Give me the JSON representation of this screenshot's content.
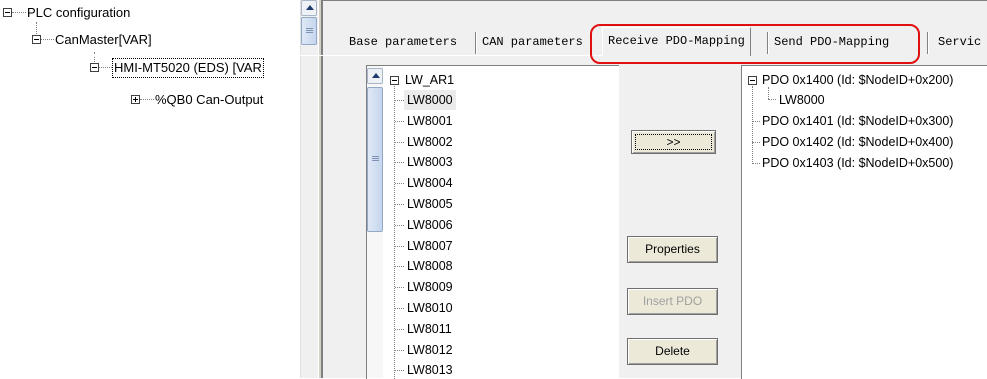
{
  "left_tree": {
    "nodes": [
      {
        "label": "PLC configuration"
      },
      {
        "label": "CanMaster[VAR]"
      },
      {
        "label": "HMI-MT5020 (EDS)  [VAR"
      },
      {
        "label": "%QB0 Can-Output"
      }
    ]
  },
  "tabs": {
    "base": "Base parameters",
    "can": "CAN parameters",
    "receive": "Receive PDO-Mapping",
    "send": "Send PDO-Mapping",
    "service": "Servic"
  },
  "source_list": {
    "root": "LW_AR1",
    "items": [
      "LW8000",
      "LW8001",
      "LW8002",
      "LW8003",
      "LW8004",
      "LW8005",
      "LW8006",
      "LW8007",
      "LW8008",
      "LW8009",
      "LW8010",
      "LW8011",
      "LW8012",
      "LW8013"
    ]
  },
  "buttons": {
    "map": ">>",
    "properties": "Properties",
    "insert_pdo": "Insert PDO",
    "delete": "Delete"
  },
  "pdo_tree": {
    "pdo0": "PDO 0x1400 (Id: $NodeID+0x200)",
    "pdo0_child": "LW8000",
    "pdo1": "PDO 0x1401 (Id: $NodeID+0x300)",
    "pdo2": "PDO 0x1402 (Id: $NodeID+0x400)",
    "pdo3": "PDO 0x1403 (Id: $NodeID+0x500)"
  },
  "colors": {
    "highlight": "#e01010",
    "scroll_accent": "#1f3c6e"
  }
}
